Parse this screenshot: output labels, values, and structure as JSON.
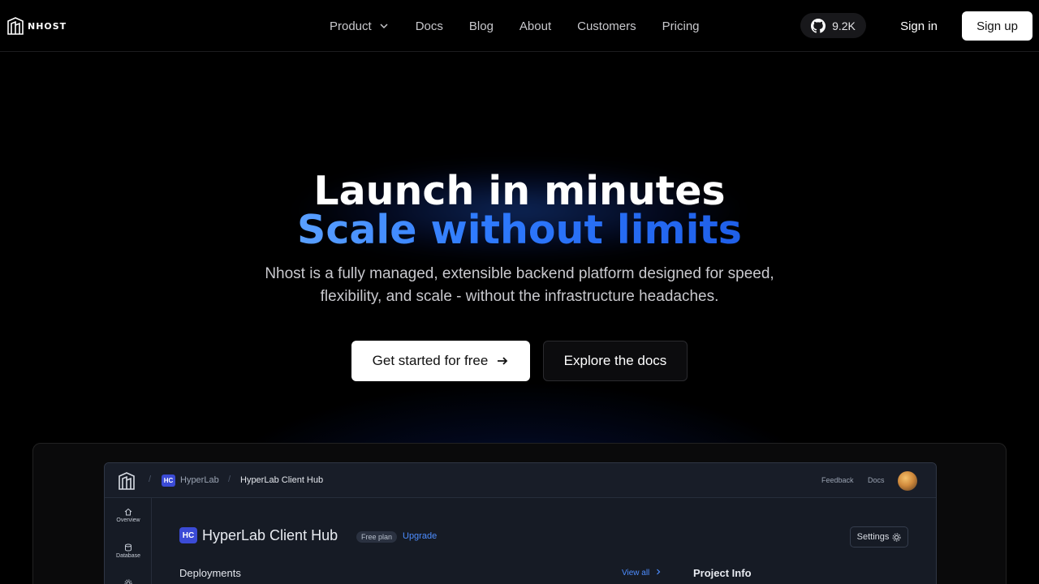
{
  "brand": {
    "name": "NHOST"
  },
  "nav": {
    "links": [
      {
        "label": "Product",
        "has_dropdown": true
      },
      {
        "label": "Docs"
      },
      {
        "label": "Blog"
      },
      {
        "label": "About"
      },
      {
        "label": "Customers"
      },
      {
        "label": "Pricing"
      }
    ],
    "github_stars": "9.2K",
    "sign_in": "Sign in",
    "sign_up": "Sign up"
  },
  "hero": {
    "title_line1": "Launch in minutes",
    "title_line2": "Scale without limits",
    "subtitle_line1": "Nhost is a fully managed, extensible backend platform designed for speed,",
    "subtitle_line2": "flexibility, and scale - without the infrastructure headaches.",
    "primary_cta": "Get started for free",
    "secondary_cta": "Explore the docs"
  },
  "preview": {
    "org_badge": "HC",
    "org_name": "HyperLab",
    "project_breadcrumb": "HyperLab Client Hub",
    "feedback": "Feedback",
    "docs": "Docs",
    "sidebar": [
      {
        "label": "Overview",
        "icon": "home-icon"
      },
      {
        "label": "Database",
        "icon": "database-icon"
      }
    ],
    "project_title": "HyperLab Client Hub",
    "plan": "Free plan",
    "upgrade": "Upgrade",
    "settings": "Settings",
    "deployments": "Deployments",
    "view_all": "View all",
    "project_info": "Project Info"
  },
  "colors": {
    "accent_blue": "#2f7bff",
    "background": "#000000"
  }
}
